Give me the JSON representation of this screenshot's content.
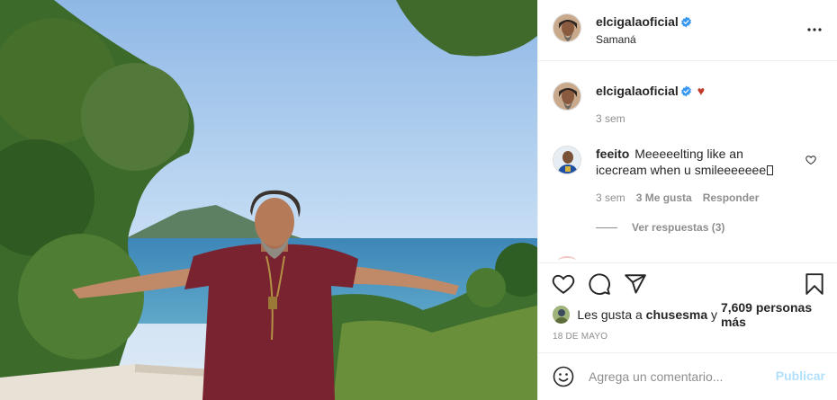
{
  "post": {
    "username": "elcigalaoficial",
    "location": "Samaná",
    "more_icon": "more-horizontal-icon",
    "verified_color": "#3897f0"
  },
  "caption": {
    "username": "elcigalaoficial",
    "heart_emoji": "♥",
    "time": "3 sem"
  },
  "comment": {
    "username": "feeito",
    "text": "Meeeeelting like an icecream when u smileeeeeee",
    "time": "3 sem",
    "likes": "3 Me gusta",
    "reply": "Responder",
    "view_replies": "Ver respuestas (3)"
  },
  "likes": {
    "prefix": "Les gusta a ",
    "first_user": "chusesma",
    "joiner": " y ",
    "others": "7,609 personas más"
  },
  "date": "18 DE MAYO",
  "add_comment": {
    "placeholder": "Agrega un comentario...",
    "publish": "Publicar"
  },
  "colors": {
    "publish_disabled": "#b2dffc",
    "secondary_text": "#8e8e8e",
    "heart_red": "#c0392b"
  }
}
